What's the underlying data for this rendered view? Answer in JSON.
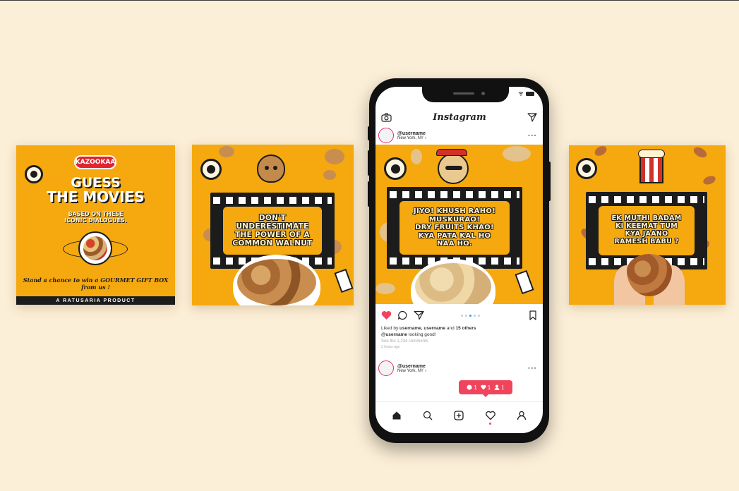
{
  "colors": {
    "background": "#fcefd7",
    "card": "#f5a90f",
    "dark": "#1c1c1c",
    "instagram_pink": "#f0445d",
    "brand_red": "#e0252f"
  },
  "cards": {
    "card1": {
      "brand": "KAZOOKAA",
      "title_line1": "GUESS",
      "title_line2": "THE MOVIES",
      "subtitle_line1": "BASED ON THESE",
      "subtitle_line2": "ICONIC DIALOGUES.",
      "tagline_line1": "Stand a chance to win a GOURMET GIFT BOX",
      "tagline_line2": "from us !",
      "footer": "A RATUSARIA PRODUCT"
    },
    "card2": {
      "line1": "DON'T",
      "line2": "UNDERESTIMATE",
      "line3": "THE POWER OF A",
      "line4": "COMMON WALNUT"
    },
    "card4": {
      "line1": "EK MUTHI BADAM",
      "line2": "KI KEEMAT TUM",
      "line3": "KYA JAANO",
      "line4": "RAMESH BABU ?"
    }
  },
  "phone": {
    "app_title": "Instagram",
    "post": {
      "username": "@username",
      "location": "New York, NY",
      "image_text": {
        "line1": "JIYO! KHUSH RAHO!",
        "line2": "MUSKURAO!",
        "line3": "DRY FRUITS KHAO!",
        "line4": "KYA PATA KAL HO",
        "line5": "NAA HO."
      },
      "liked_by_prefix": "Liked by",
      "liked_by_names": "username, username",
      "liked_by_and": "and",
      "liked_by_others": "15 others",
      "caption_user": "@username",
      "caption_text": "looking good!",
      "comments_link": "See the 1,234 comments",
      "time_ago": "3 hours ago"
    },
    "second_post": {
      "username": "@username",
      "location": "New York, NY"
    },
    "notification": {
      "comments": "1",
      "likes": "1",
      "follows": "1"
    },
    "icons": {
      "camera": "camera-icon",
      "direct": "direct-message-icon",
      "more": "more-icon",
      "like": "heart-icon",
      "comment": "comment-icon",
      "share": "share-icon",
      "save": "bookmark-icon",
      "home": "home-icon",
      "search": "search-icon",
      "add": "add-post-icon",
      "activity": "activity-icon",
      "profile": "profile-icon"
    }
  }
}
